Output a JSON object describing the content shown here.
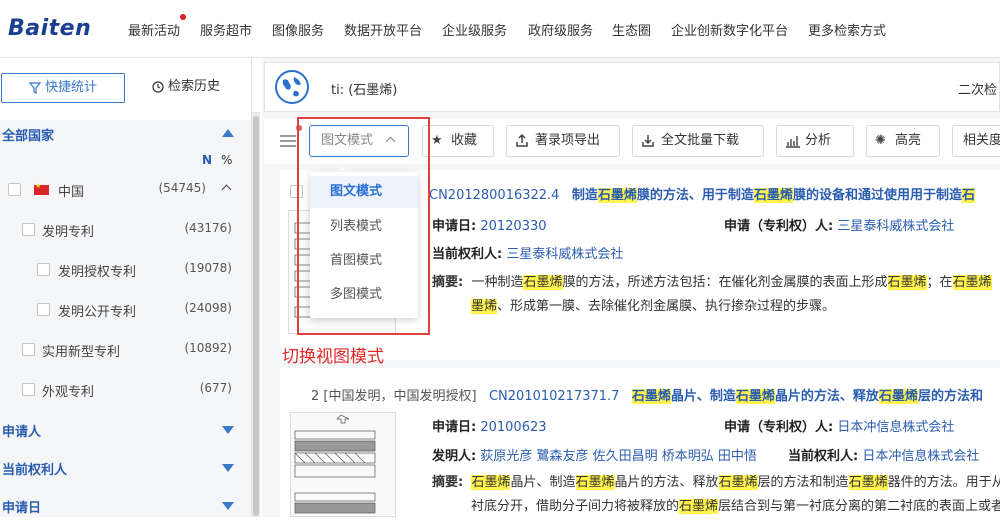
{
  "nav": {
    "logo": "Baiten",
    "items": [
      "最新活动",
      "服务超市",
      "图像服务",
      "数据开放平台",
      "企业级服务",
      "政府级服务",
      "生态圈",
      "企业创新数字化平台",
      "更多检索方式"
    ]
  },
  "sidebar": {
    "tab_stats": "快捷统计",
    "tab_history": "检索历史",
    "all_countries": "全部国家",
    "n_label": "N",
    "pct_label": "%",
    "tree": [
      {
        "label": "中国",
        "count": "(54745)"
      },
      {
        "label": "发明专利",
        "count": "(43176)"
      },
      {
        "label": "发明授权专利",
        "count": "(19078)"
      },
      {
        "label": "发明公开专利",
        "count": "(24098)"
      },
      {
        "label": "实用新型专利",
        "count": "(10892)"
      },
      {
        "label": "外观专利",
        "count": "(677)"
      }
    ],
    "sections": [
      "申请人",
      "当前权利人",
      "申请日"
    ]
  },
  "search": {
    "query": "ti: (石墨烯)",
    "right_text": "二次检"
  },
  "toolbar": {
    "mode": "图文模式",
    "collect": "收藏",
    "export_biblio": "著录项导出",
    "bulk_download": "全文批量下载",
    "analyze": "分析",
    "highlight": "高亮",
    "relevance": "相关度"
  },
  "dropdown": {
    "options": [
      "图文模式",
      "列表模式",
      "首图模式",
      "多图模式"
    ],
    "selected": "图文模式"
  },
  "annotation": "切换视图模式",
  "results": [
    {
      "pub": "CN201280016322.4",
      "title_parts": [
        "制造",
        "石墨烯",
        "膜的方法、用于制造",
        "石墨烯",
        "膜的设备和通过使用用于制造",
        "石"
      ],
      "apply_date_label": "申请日:",
      "apply_date": "20120330",
      "applicant_label": "申请（专利权）人:",
      "applicant": "三星泰科威株式会社",
      "owner_label": "当前权利人:",
      "owner": "三星泰科威株式会社",
      "abstract_label": "摘要:",
      "abstract_l1": [
        "一种制造",
        "石墨烯",
        "膜的方法，所述方法包括：在催化剂金属膜的表面上形成",
        "石墨烯",
        "；在",
        "石墨烯"
      ],
      "abstract_l2": [
        "墨烯",
        "、形成第一膜、去除催化剂金属膜、执行掺杂过程的步骤。"
      ]
    },
    {
      "num": "2",
      "tags": "[中国发明，中国发明授权]",
      "pub": "CN201010217371.7",
      "title_parts": [
        "石墨烯",
        "晶片、制造",
        "石墨烯",
        "晶片的方法、释放",
        "石墨烯",
        "层的方法和"
      ],
      "apply_date_label": "申请日:",
      "apply_date": "20100623",
      "applicant_label": "申请（专利权）人:",
      "applicant": "日本冲信息株式会社",
      "inventor_label": "发明人:",
      "inventor": "荻原光彦 鷺森友彦 佐久田昌明 桥本明弘 田中悟",
      "owner_label": "当前权利人:",
      "owner": "日本冲信息株式会社",
      "abstract_label": "摘要:",
      "abstract_l1": [
        "石墨烯",
        "晶片、制造",
        "石墨烯",
        "晶片的方法、释放",
        "石墨烯",
        "层的方法和制造",
        "石墨烯",
        "器件的方法。用于从"
      ],
      "abstract_l2": [
        "衬底分开，借助分子间力将被释放的",
        "石墨烯",
        "层结合到与第一衬底分离的第二衬底的表面上或者"
      ]
    }
  ]
}
